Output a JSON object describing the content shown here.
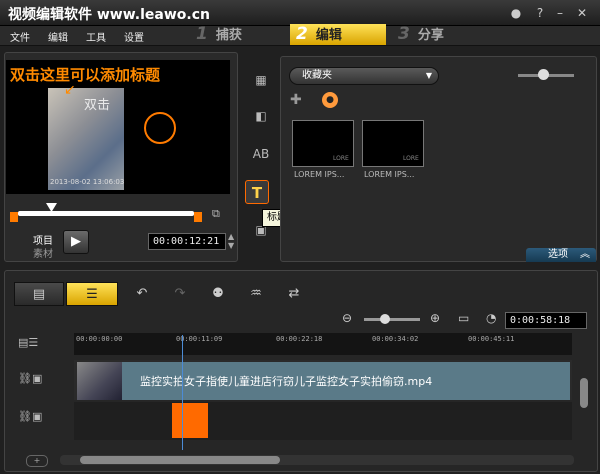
{
  "app": {
    "title": "视频编辑软件 www.leawo.cn"
  },
  "menu": [
    "文件",
    "编辑",
    "工具",
    "设置"
  ],
  "steps": [
    {
      "num": "1",
      "label": "捕获"
    },
    {
      "num": "2",
      "label": "编辑"
    },
    {
      "num": "3",
      "label": "分享"
    }
  ],
  "preview": {
    "tip": "双击这里可以添加标题",
    "overlay_text": "双击",
    "video_date": "2013-08-02 13:06:03",
    "project_label": "项目",
    "clip_label": "素材",
    "timecode": "00:00:12:21"
  },
  "library": {
    "dropdown_value": "收藏夹",
    "thumbs": [
      "LOREM IPS...",
      "LOREM IPS..."
    ],
    "thumb_badge": "LORE",
    "options_label": "选项",
    "tooltip": "标题"
  },
  "timeline": {
    "ruler_labels": [
      "00:00:00:00",
      "00:00:11:09",
      "00:00:22:18",
      "00:00:34:02",
      "00:00:45:11"
    ],
    "duration": "0:00:58:18",
    "clip_title": "监控实拍女子指使儿童进店行窃儿子监控女子实拍偷窃.mp4"
  }
}
